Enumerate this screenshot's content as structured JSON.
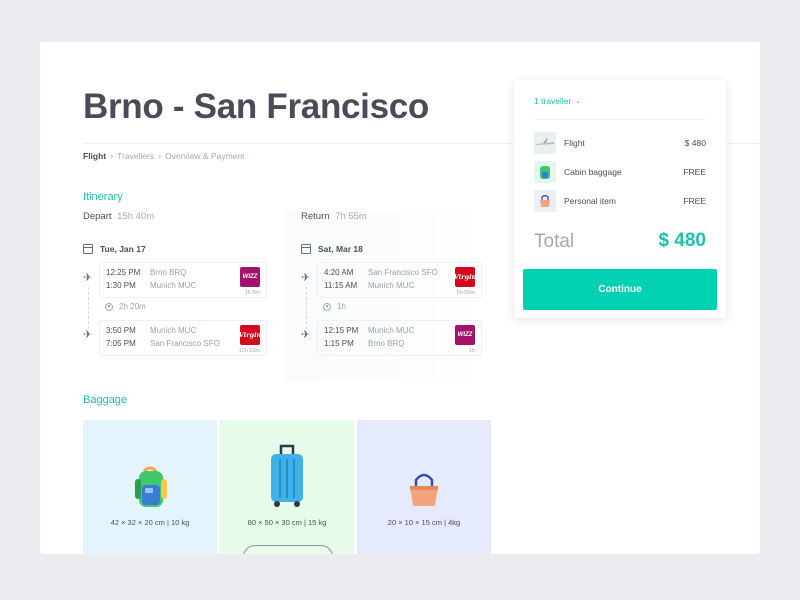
{
  "trip": {
    "title": "Brno - San Francisco"
  },
  "breadcrumb": [
    "Flight",
    "Travellers",
    "Overview & Payment"
  ],
  "itinerary": {
    "heading": "Itinerary",
    "depart": {
      "label": "Depart",
      "duration": "15h 40m",
      "date": "Tue, Jan 17",
      "segments": [
        {
          "dep_time": "12:25 PM",
          "arr_time": "1:30 PM",
          "from": "Brno BRQ",
          "to": "Munich MUC",
          "airline_logo": "WIZZ",
          "airline_icon": "wizz-air-logo",
          "flight_time": "1h 5m"
        },
        {
          "dep_time": "3:50 PM",
          "arr_time": "7:05 PM",
          "from": "Munich MUC",
          "to": "San Francisco SFO",
          "airline_logo": "Virgin",
          "airline_icon": "virgin-atlantic-logo",
          "flight_time": "12h 15m"
        }
      ],
      "layover": "2h 20m"
    },
    "return": {
      "label": "Return",
      "duration": "7h 55m",
      "date": "Sat, Mar 18",
      "segments": [
        {
          "dep_time": "4:20 AM",
          "arr_time": "11:15 AM",
          "from": "San Francisco SFO",
          "to": "Munich MUC",
          "airline_logo": "Virgin",
          "airline_icon": "virgin-atlantic-logo",
          "flight_time": "5h 55m"
        },
        {
          "dep_time": "12:15 PM",
          "arr_time": "1:15 PM",
          "from": "Munich MUC",
          "to": "Brno BRQ",
          "airline_logo": "WIZZ",
          "airline_icon": "wizz-air-logo",
          "flight_time": "1h"
        }
      ],
      "layover": "1h"
    }
  },
  "baggage": {
    "heading": "Baggage",
    "options": [
      {
        "icon": "backpack-icon",
        "dims": "42 × 32 × 20 cm | 10 kg",
        "bg": "#e3f4fd"
      },
      {
        "icon": "suitcase-icon",
        "dims": "80 × 50 × 30 cm | 15 kg",
        "bg": "#e6fbea"
      },
      {
        "icon": "handbag-icon",
        "dims": "20 × 10 × 15 cm | 4kg",
        "bg": "#e6eafd"
      }
    ]
  },
  "summary": {
    "travellers": "1 traveller",
    "items": [
      {
        "icon": "airplane-icon",
        "name": "Flight",
        "price": "$ 480"
      },
      {
        "icon": "backpack-icon",
        "name": "Cabin baggage",
        "price": "FREE"
      },
      {
        "icon": "handbag-icon",
        "name": "Personal item",
        "price": "FREE"
      }
    ],
    "total_label": "Total",
    "total_value": "$ 480",
    "continue_label": "Continue"
  },
  "colors": {
    "accent": "#1fbfae",
    "button": "#00d1b2",
    "text": "#4a4d5c",
    "muted": "#a3a8b3",
    "wizz": "#a5126b",
    "virgin": "#d5091e"
  }
}
